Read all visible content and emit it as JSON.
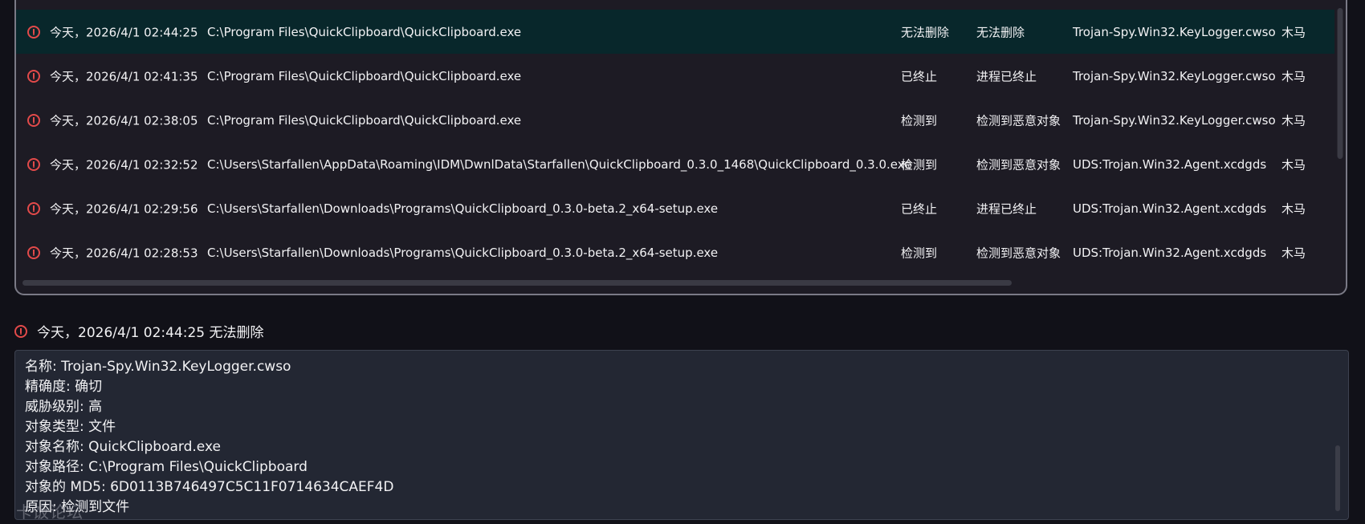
{
  "table": {
    "rows": [
      {
        "time": "今天，2026/4/1 02:44:25",
        "path": "C:\\Program Files\\QuickClipboard\\QuickClipboard.exe",
        "status": "无法删除",
        "action": "无法删除",
        "threat_name": "Trojan-Spy.Win32.KeyLogger.cwso",
        "type": "木马",
        "selected": true
      },
      {
        "time": "今天，2026/4/1 02:41:35",
        "path": "C:\\Program Files\\QuickClipboard\\QuickClipboard.exe",
        "status": "已终止",
        "action": "进程已终止",
        "threat_name": "Trojan-Spy.Win32.KeyLogger.cwso",
        "type": "木马",
        "selected": false
      },
      {
        "time": "今天，2026/4/1 02:38:05",
        "path": "C:\\Program Files\\QuickClipboard\\QuickClipboard.exe",
        "status": "检测到",
        "action": "检测到恶意对象",
        "threat_name": "Trojan-Spy.Win32.KeyLogger.cwso",
        "type": "木马",
        "selected": false
      },
      {
        "time": "今天，2026/4/1 02:32:52",
        "path": "C:\\Users\\Starfallen\\AppData\\Roaming\\IDM\\DwnlData\\Starfallen\\QuickClipboard_0.3.0_1468\\QuickClipboard_0.3.0.exe",
        "status": "检测到",
        "action": "检测到恶意对象",
        "threat_name": "UDS:Trojan.Win32.Agent.xcdgds",
        "type": "木马",
        "selected": false
      },
      {
        "time": "今天，2026/4/1 02:29:56",
        "path": "C:\\Users\\Starfallen\\Downloads\\Programs\\QuickClipboard_0.3.0-beta.2_x64-setup.exe",
        "status": "已终止",
        "action": "进程已终止",
        "threat_name": "UDS:Trojan.Win32.Agent.xcdgds",
        "type": "木马",
        "selected": false
      },
      {
        "time": "今天，2026/4/1 02:28:53",
        "path": "C:\\Users\\Starfallen\\Downloads\\Programs\\QuickClipboard_0.3.0-beta.2_x64-setup.exe",
        "status": "检测到",
        "action": "检测到恶意对象",
        "threat_name": "UDS:Trojan.Win32.Agent.xcdgds",
        "type": "木马",
        "selected": false
      }
    ]
  },
  "detail": {
    "header": "今天，2026/4/1 02:44:25 无法删除",
    "lines": [
      "名称: Trojan-Spy.Win32.KeyLogger.cwso",
      "精确度: 确切",
      "威胁级别: 高",
      "对象类型: 文件",
      "对象名称: QuickClipboard.exe",
      "对象路径: C:\\Program Files\\QuickClipboard",
      "对象的 MD5: 6D0113B746497C5C11F0714634CAEF4D",
      "原因: 检测到文件"
    ]
  },
  "watermark": "卡饭论坛",
  "icons": {
    "alert": "alert-circle-icon"
  },
  "colors": {
    "alert_red": "#e24a4a",
    "selected_row": "#08272b"
  }
}
